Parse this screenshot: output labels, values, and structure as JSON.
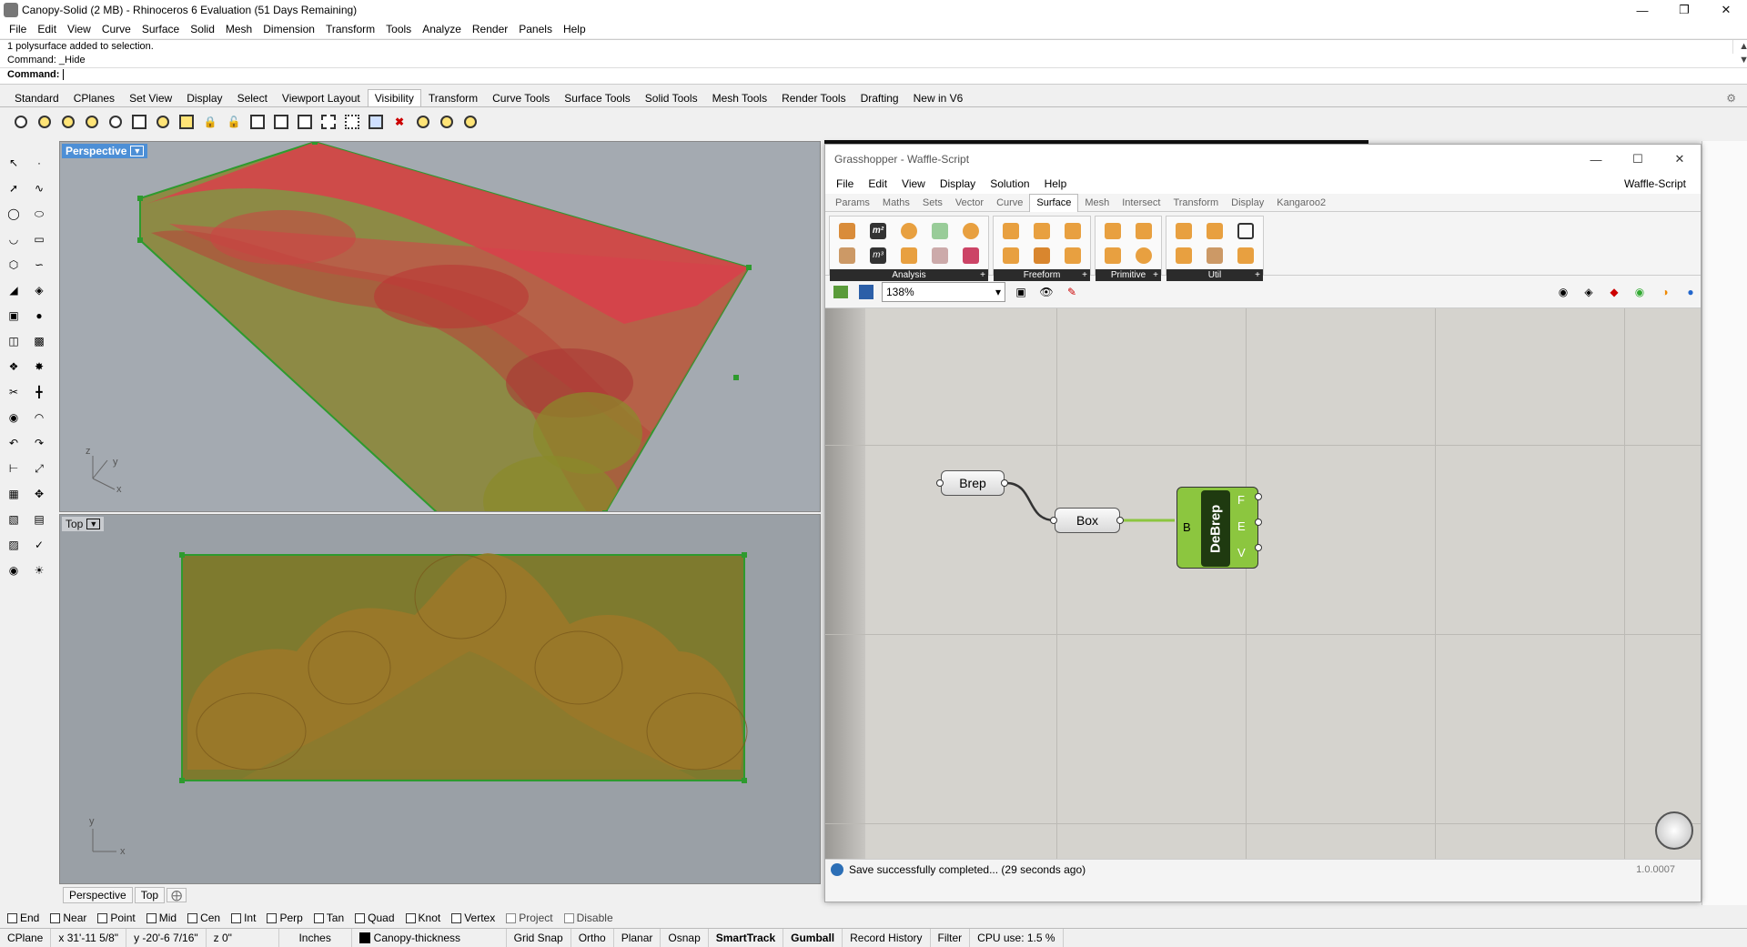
{
  "window": {
    "title": "Canopy-Solid (2 MB) - Rhinoceros 6 Evaluation (51 Days Remaining)"
  },
  "menu": [
    "File",
    "Edit",
    "View",
    "Curve",
    "Surface",
    "Solid",
    "Mesh",
    "Dimension",
    "Transform",
    "Tools",
    "Analyze",
    "Render",
    "Panels",
    "Help"
  ],
  "command": {
    "history1": "1 polysurface added to selection.",
    "history2": "Command: _Hide",
    "prompt": "Command:"
  },
  "toolbar_tabs": [
    "Standard",
    "CPlanes",
    "Set View",
    "Display",
    "Select",
    "Viewport Layout",
    "Visibility",
    "Transform",
    "Curve Tools",
    "Surface Tools",
    "Solid Tools",
    "Mesh Tools",
    "Render Tools",
    "Drafting",
    "New in V6"
  ],
  "active_toolbar_tab": "Visibility",
  "viewports": {
    "perspective": "Perspective",
    "top": "Top"
  },
  "viewport_tabs": [
    "Perspective",
    "Top"
  ],
  "osnaps": [
    "End",
    "Near",
    "Point",
    "Mid",
    "Cen",
    "Int",
    "Perp",
    "Tan",
    "Quad",
    "Knot",
    "Vertex",
    "Project",
    "Disable"
  ],
  "status": {
    "cplane": "CPlane",
    "x": "x 31'-11 5/8\"",
    "y": "y -20'-6 7/16\"",
    "z": "z 0\"",
    "units": "Inches",
    "layer": "Canopy-thickness",
    "grid_snap": "Grid Snap",
    "ortho": "Ortho",
    "planar": "Planar",
    "osnap": "Osnap",
    "smarttrack": "SmartTrack",
    "gumball": "Gumball",
    "record_history": "Record History",
    "filter": "Filter",
    "cpu": "CPU use: 1.5 %"
  },
  "gh": {
    "title": "Grasshopper - Waffle-Script",
    "menu": [
      "File",
      "Edit",
      "View",
      "Display",
      "Solution",
      "Help"
    ],
    "doc_name": "Waffle-Script",
    "tabs": [
      "Params",
      "Maths",
      "Sets",
      "Vector",
      "Curve",
      "Surface",
      "Mesh",
      "Intersect",
      "Transform",
      "Display",
      "Kangaroo2"
    ],
    "active_tab": "Surface",
    "groups": [
      "Analysis",
      "Freeform",
      "Primitive",
      "Util"
    ],
    "zoom": "138%",
    "nodes": {
      "brep": "Brep",
      "box": "Box",
      "debrep": "DeBrep",
      "debrep_in": "B",
      "out_f": "F",
      "out_e": "E",
      "out_v": "V"
    },
    "status": "Save successfully completed... (29 seconds ago)",
    "version": "1.0.0007"
  },
  "colors": {
    "accent": "#4d8fd6",
    "gh_component": "#8cc63f",
    "model_red": "#d9404a",
    "model_olive": "#8a8a2a"
  }
}
